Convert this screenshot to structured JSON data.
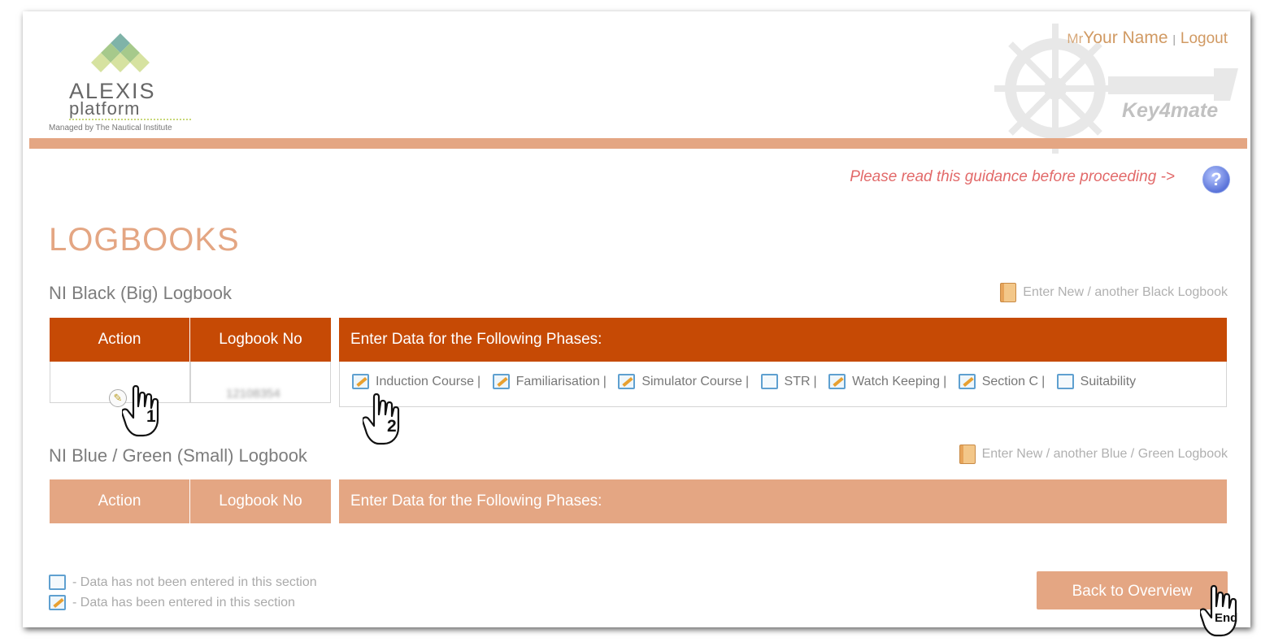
{
  "header": {
    "logo_line1": "ALEXIS",
    "logo_line2": "platform",
    "logo_tagline": "Managed by The Nautical Institute",
    "watermark_text": "Key4mate",
    "salutation": "Mr",
    "user_name": "Your Name",
    "separator": "|",
    "logout_label": "Logout"
  },
  "guidance": {
    "text": "Please read this guidance before proceeding ->",
    "help_icon": "?"
  },
  "page_title": "LOGBOOKS",
  "black_logbook": {
    "title": "NI Black (Big) Logbook",
    "enter_new_label": "Enter New / another Black Logbook",
    "columns": [
      "Action",
      "Logbook No",
      "Enter Data for the Following Phases:"
    ],
    "row": {
      "logbook_no": "12108354",
      "phases": [
        {
          "label": "Induction Course",
          "icon": "data-entered-icon"
        },
        {
          "label": "Familiarisation",
          "icon": "data-entered-icon"
        },
        {
          "label": "Simulator Course",
          "icon": "data-entered-icon"
        },
        {
          "label": "STR",
          "icon": "no-data-icon"
        },
        {
          "label": "Watch Keeping",
          "icon": "data-entered-icon"
        },
        {
          "label": "Section C",
          "icon": "data-entered-icon"
        },
        {
          "label": "Suitability",
          "icon": "no-data-icon"
        }
      ],
      "separator": "|"
    }
  },
  "blue_green_logbook": {
    "title": "NI Blue / Green (Small) Logbook",
    "enter_new_label": "Enter New / another Blue / Green Logbook",
    "columns": [
      "Action",
      "Logbook No",
      "Enter Data for the Following Phases:"
    ]
  },
  "legend": {
    "not_entered": "- Data has not been entered in this section",
    "entered": "- Data has been entered in this section"
  },
  "back_button_label": "Back to Overview",
  "annotations": {
    "step1": "1",
    "step2": "2",
    "end": "End"
  },
  "colors": {
    "accent_dark": "#c64a05",
    "accent_light": "#e4a683",
    "guidance_red": "#e26a6a"
  }
}
